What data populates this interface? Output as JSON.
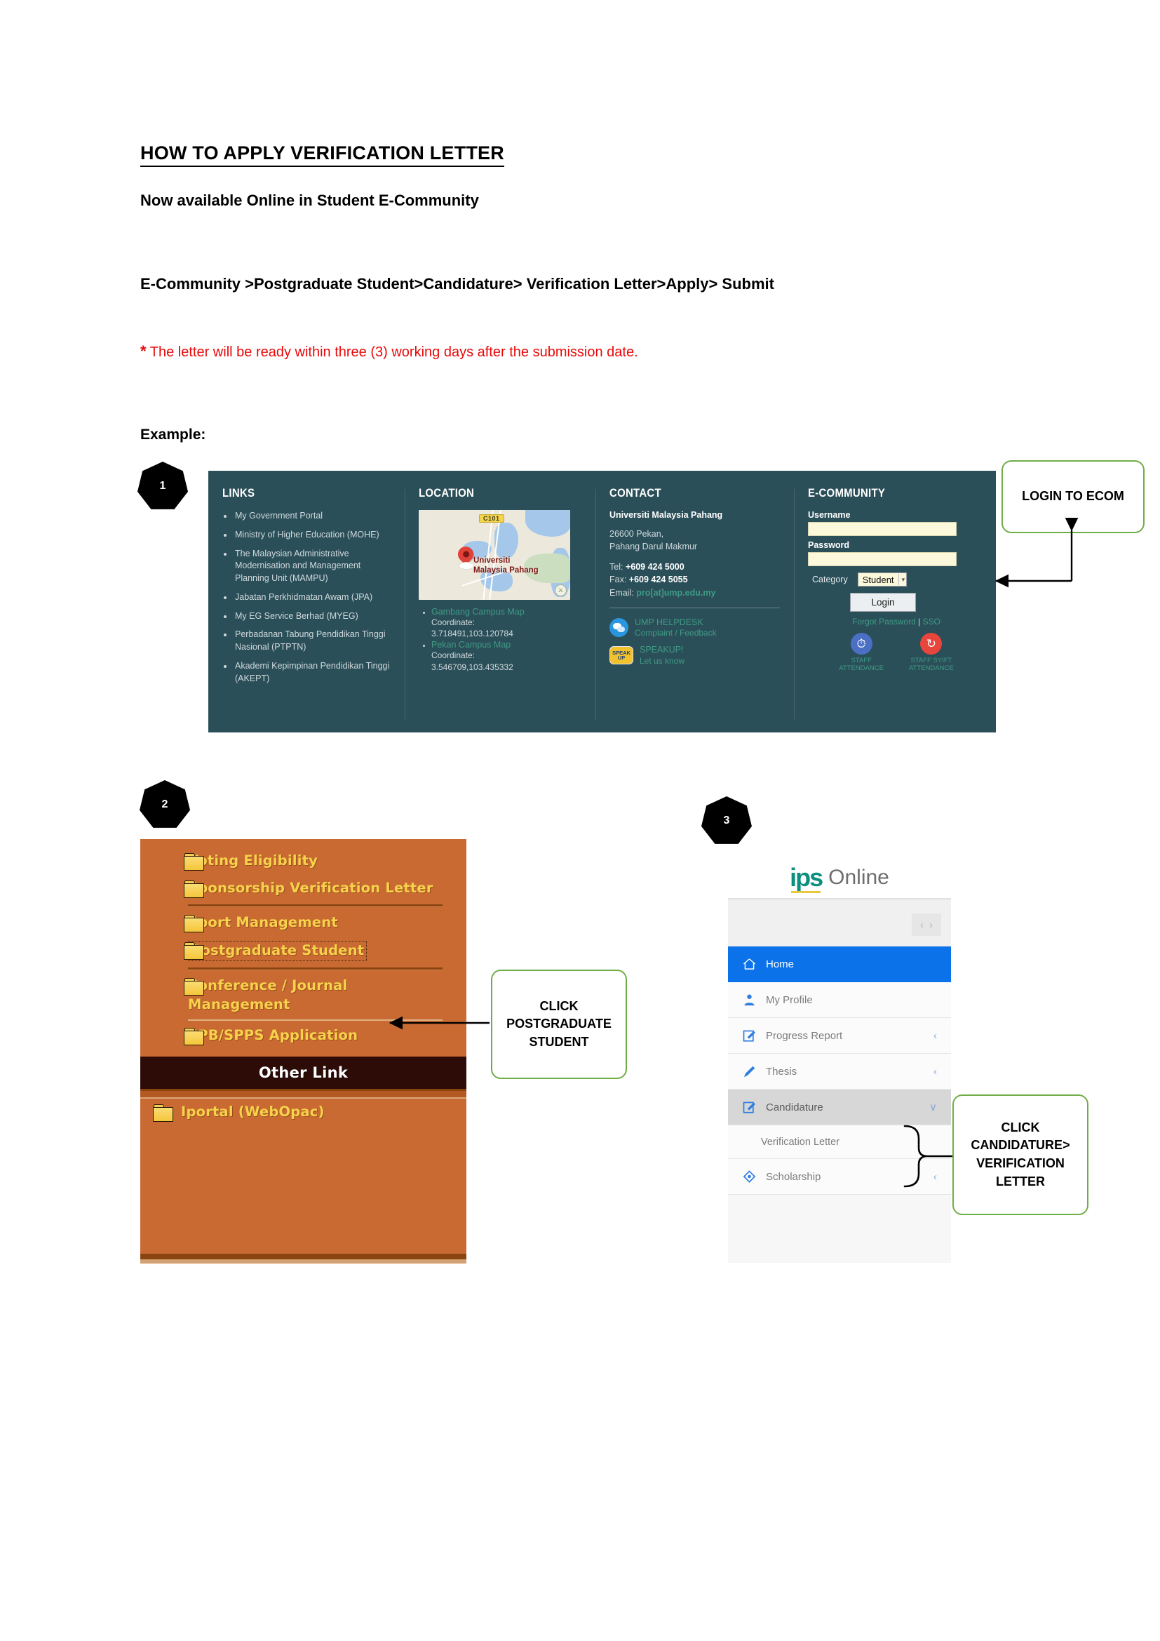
{
  "document": {
    "title": "HOW TO APPLY VERIFICATION LETTER",
    "subtitle": "Now available Online in Student E-Community",
    "path": "E-Community >Postgraduate Student>Candidature> Verification Letter>Apply> Submit",
    "note_asterisk": "*",
    "note": "The letter will be ready within three (3) working days after the submission date.",
    "example_label": "Example:",
    "note_color": "#e8090a",
    "accent_green": "#70ad47"
  },
  "steps": [
    {
      "number": "1"
    },
    {
      "number": "2"
    },
    {
      "number": "3"
    }
  ],
  "callouts": {
    "login": "LOGIN TO ECOM",
    "postgraduate": "CLICK POSTGRADUATE STUDENT",
    "candidature": "CLICK CANDIDATURE> VERIFICATION LETTER"
  },
  "footer_screenshot": {
    "links": {
      "heading": "LINKS",
      "items": [
        "My Government Portal",
        "Ministry of Higher Education (MOHE)",
        "The Malaysian Administrative Modernisation and Management Planning Unit (MAMPU)",
        "Jabatan Perkhidmatan Awam (JPA)",
        "My EG Service Berhad (MYEG)",
        "Perbadanan Tabung Pendidikan Tinggi Nasional (PTPTN)",
        "Akademi Kepimpinan Pendidikan Tinggi (AKEPT)"
      ]
    },
    "location": {
      "heading": "LOCATION",
      "map": {
        "road_badge": "C101",
        "pin_label_line1": "Universiti",
        "pin_label_line2": "Malaysia Pahang"
      },
      "entries": [
        {
          "link": "Gambang Campus Map",
          "coord_label": "Coordinate:",
          "coord": "3.718491,103.120784"
        },
        {
          "link": "Pekan Campus Map",
          "coord_label": "Coordinate:",
          "coord": "3.546709,103.435332"
        }
      ]
    },
    "contact": {
      "heading": "CONTACT",
      "org": "Universiti Malaysia Pahang",
      "address_line1": "26600 Pekan,",
      "address_line2": "Pahang Darul Makmur",
      "tel_label": "Tel:",
      "tel": "+609 424 5000",
      "fax_label": "Fax:",
      "fax": "+609 424 5055",
      "email_label": "Email:",
      "email": "pro[at]ump.edu.my",
      "helpdesk_title": "UMP HELPDESK",
      "helpdesk_sub": "Complaint / Feedback",
      "speakup_title": "SPEAKUP!",
      "speakup_sub": "Let us know",
      "speakup_icon_text": "SPEAK UP"
    },
    "ecommunity": {
      "heading": "E-COMMUNITY",
      "username_label": "Username",
      "username_value": "",
      "password_label": "Password",
      "password_value": "",
      "category_label": "Category",
      "category_value": "Student",
      "category_options": [
        "Student"
      ],
      "login_button": "Login",
      "forgot_password": "Forgot Password",
      "sso": "SSO",
      "separator": "|",
      "staff_attendance_line1": "STAFF",
      "staff_attendance_line2": "ATTENDANCE",
      "staff_syift_line1": "STAFF SYIFT",
      "staff_syift_line2": "ATTENDANCE"
    }
  },
  "orange_menu": {
    "items": [
      {
        "label": "Voting Eligibility",
        "selected": false,
        "sep_after": "none"
      },
      {
        "label": "Sponsorship Verification Letter",
        "selected": false,
        "sep_after": "thick"
      },
      {
        "label": "Sport Management",
        "selected": false,
        "sep_after": "none"
      },
      {
        "label": "Postgraduate Student",
        "selected": true,
        "sep_after": "thick"
      },
      {
        "label": "Conference / Journal Management",
        "selected": false,
        "sep_after": "thin"
      },
      {
        "label": "SPB/SPPS Application",
        "selected": false,
        "sep_after": "none"
      }
    ],
    "other_link_header": "Other Link",
    "other_items": [
      {
        "label": "Iportal (WebOpac)"
      }
    ]
  },
  "ips_online": {
    "logo_mark": "ips",
    "logo_word": "Online",
    "nav_prev": "‹",
    "nav_next": "›",
    "menu": [
      {
        "label": "Home",
        "icon": "home-icon",
        "state": "active",
        "chevron": ""
      },
      {
        "label": "My Profile",
        "icon": "profile-icon",
        "state": "normal",
        "chevron": ""
      },
      {
        "label": "Progress Report",
        "icon": "edit-square-icon",
        "state": "normal",
        "chevron": "‹"
      },
      {
        "label": "Thesis",
        "icon": "pencil-icon",
        "state": "normal",
        "chevron": "‹"
      },
      {
        "label": "Candidature",
        "icon": "edit-square-icon",
        "state": "hover",
        "chevron": "∨"
      }
    ],
    "submenu": [
      {
        "label": "Verification Letter"
      }
    ],
    "menu_after": [
      {
        "label": "Scholarship",
        "icon": "ribbon-icon",
        "state": "normal",
        "chevron": "‹"
      }
    ]
  }
}
